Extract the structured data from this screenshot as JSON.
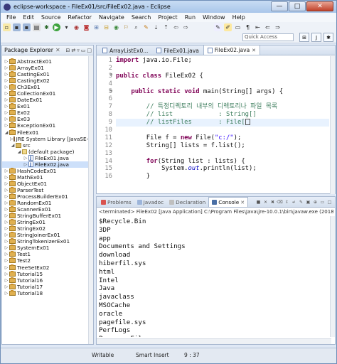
{
  "window": {
    "title": "eclipse-workspace - FileEx01/src/FileEx02.java - Eclipse",
    "min": "—",
    "max": "□",
    "close": "✕"
  },
  "menu": [
    "File",
    "Edit",
    "Source",
    "Refactor",
    "Navigate",
    "Search",
    "Project",
    "Run",
    "Window",
    "Help"
  ],
  "toolbar": {
    "quick_access": "Quick Access"
  },
  "package_explorer": {
    "title": "Package Explorer",
    "items": [
      {
        "label": "AbstractEx01",
        "kind": "project",
        "depth": 0,
        "arrow": "▷"
      },
      {
        "label": "ArrayEx01",
        "kind": "project",
        "depth": 0,
        "arrow": "▷"
      },
      {
        "label": "CastingEx01",
        "kind": "project",
        "depth": 0,
        "arrow": "▷"
      },
      {
        "label": "CastingEx02",
        "kind": "project",
        "depth": 0,
        "arrow": "▷"
      },
      {
        "label": "Ch3Ex01",
        "kind": "project",
        "depth": 0,
        "arrow": "▷"
      },
      {
        "label": "CollectionEx01",
        "kind": "project",
        "depth": 0,
        "arrow": "▷"
      },
      {
        "label": "DateEx01",
        "kind": "project",
        "depth": 0,
        "arrow": "▷"
      },
      {
        "label": "Ex01",
        "kind": "project",
        "depth": 0,
        "arrow": "▷"
      },
      {
        "label": "Ex02",
        "kind": "project",
        "depth": 0,
        "arrow": "▷"
      },
      {
        "label": "Ex03",
        "kind": "project",
        "depth": 0,
        "arrow": "▷"
      },
      {
        "label": "ExceptionEx01",
        "kind": "project",
        "depth": 0,
        "arrow": "▷"
      },
      {
        "label": "FileEx01",
        "kind": "project",
        "depth": 0,
        "arrow": "◢"
      },
      {
        "label": "JRE System Library [JavaSE-10]",
        "kind": "jar",
        "depth": 1,
        "arrow": "▷"
      },
      {
        "label": "src",
        "kind": "folder",
        "depth": 1,
        "arrow": "◢"
      },
      {
        "label": "(default package)",
        "kind": "package",
        "depth": 2,
        "arrow": "◢"
      },
      {
        "label": "FileEx01.java",
        "kind": "java",
        "depth": 3,
        "arrow": "▷"
      },
      {
        "label": "FileEx02.java",
        "kind": "java",
        "depth": 3,
        "arrow": "▷",
        "selected": true
      },
      {
        "label": "HashCodeEx01",
        "kind": "project",
        "depth": 0,
        "arrow": "▷"
      },
      {
        "label": "MathEx01",
        "kind": "project",
        "depth": 0,
        "arrow": "▷"
      },
      {
        "label": "ObjectEx01",
        "kind": "project",
        "depth": 0,
        "arrow": "▷"
      },
      {
        "label": "ParserTest",
        "kind": "project",
        "depth": 0,
        "arrow": "▷"
      },
      {
        "label": "ProcessBuilderEx01",
        "kind": "project",
        "depth": 0,
        "arrow": "▷"
      },
      {
        "label": "RandomEx01",
        "kind": "project",
        "depth": 0,
        "arrow": "▷"
      },
      {
        "label": "ScannerEx01",
        "kind": "project",
        "depth": 0,
        "arrow": "▷"
      },
      {
        "label": "StringBufferEx01",
        "kind": "project",
        "depth": 0,
        "arrow": "▷"
      },
      {
        "label": "StringEx01",
        "kind": "project",
        "depth": 0,
        "arrow": "▷"
      },
      {
        "label": "StringEx02",
        "kind": "project",
        "depth": 0,
        "arrow": "▷"
      },
      {
        "label": "StringJoinerEx01",
        "kind": "project",
        "depth": 0,
        "arrow": "▷"
      },
      {
        "label": "StringTokenizerEx01",
        "kind": "project",
        "depth": 0,
        "arrow": "▷"
      },
      {
        "label": "SystemEx01",
        "kind": "project",
        "depth": 0,
        "arrow": "▷"
      },
      {
        "label": "Test1",
        "kind": "project",
        "depth": 0,
        "arrow": "▷"
      },
      {
        "label": "Test2",
        "kind": "project",
        "depth": 0,
        "arrow": "▷"
      },
      {
        "label": "TreeSetEx02",
        "kind": "project",
        "depth": 0,
        "arrow": "▷"
      },
      {
        "label": "Tutorial15",
        "kind": "project",
        "depth": 0,
        "arrow": "▷"
      },
      {
        "label": "Tutorial16",
        "kind": "project",
        "depth": 0,
        "arrow": "▷"
      },
      {
        "label": "Tutorial17",
        "kind": "project",
        "depth": 0,
        "arrow": "▷"
      },
      {
        "label": "Tutorial18",
        "kind": "project",
        "depth": 0,
        "arrow": "▷"
      }
    ]
  },
  "editor": {
    "tabs": [
      {
        "label": "ArrayListEx0...",
        "active": false
      },
      {
        "label": "FileEx01.java",
        "active": false
      },
      {
        "label": "FileEx02.java",
        "active": true
      }
    ],
    "line_numbers": [
      "1",
      "2",
      "3",
      "4",
      "5",
      "6",
      "7",
      "8",
      "9",
      "10",
      "11",
      "12",
      "13",
      "14",
      "15",
      "16"
    ],
    "lines": [
      {
        "html": "<span class=\"kw\">import</span> java.io.File;"
      },
      {
        "html": ""
      },
      {
        "html": "<span class=\"kw\">public</span> <span class=\"kw\">class</span> FileEx02 {"
      },
      {
        "html": ""
      },
      {
        "html": "    <span class=\"kw\">public</span> <span class=\"kw\">static</span> <span class=\"kw\">void</span> main(String[] args) {"
      },
      {
        "html": ""
      },
      {
        "html": "        <span class=\"cm\">// 특정디렉토리 내부의 디렉토리나 파일 목록</span>"
      },
      {
        "html": "        <span class=\"cm\">// list            : String[]</span>"
      },
      {
        "html": "        <span class=\"cm\">// listFiles       : File[</span><span class=\"caret\"></span>",
        "current": true
      },
      {
        "html": ""
      },
      {
        "html": "        File f = <span class=\"kw\">new</span> File(<span class=\"st\">\"c:/\"</span>);"
      },
      {
        "html": "        String[] lists = f.list();"
      },
      {
        "html": ""
      },
      {
        "html": "        <span class=\"kw\">for</span>(String list : lists) {"
      },
      {
        "html": "            System.<span class=\"it\">out</span>.println(list);"
      },
      {
        "html": "        }"
      }
    ]
  },
  "console": {
    "tabs": [
      "Problems",
      "Javadoc",
      "Declaration",
      "Console"
    ],
    "info": "<terminated> FileEx02 [Java Application] C:\\Program Files\\Java\\jre-10.0.1\\bin\\javaw.exe (2018. 6. 26",
    "output": [
      "$Recycle.Bin",
      "3DP",
      "app",
      "Documents and Settings",
      "download",
      "hiberfil.sys",
      "html",
      "Intel",
      "Java",
      "javaclass",
      "MSOCache",
      "oracle",
      "pagefile.sys",
      "PerfLogs",
      "Program Files"
    ]
  },
  "status": {
    "mode": "Writable",
    "insert": "Smart Insert",
    "position": "9 : 37"
  }
}
